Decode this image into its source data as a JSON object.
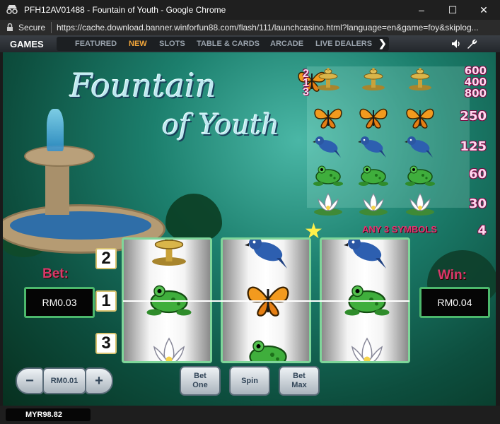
{
  "window": {
    "title": "PFH12AV01488 - Fountain of Youth - Google Chrome",
    "minimize": "–",
    "maximize": "☐",
    "close": "✕"
  },
  "address": {
    "secure_label": "Secure",
    "url": "https://cache.download.banner.winforfun88.com/flash/111/launchcasino.html?language=en&game=foy&skiplog..."
  },
  "nav": {
    "games_label": "GAMES",
    "tabs": [
      {
        "label": "FEATURED",
        "active": false
      },
      {
        "label": "NEW",
        "active": true
      },
      {
        "label": "SLOTS",
        "active": false
      },
      {
        "label": "TABLE & CARDS",
        "active": false
      },
      {
        "label": "ARCADE",
        "active": false
      },
      {
        "label": "LIVE DEALERS",
        "active": false
      }
    ],
    "next_arrow": "❯"
  },
  "game": {
    "logo_line1": "Fountain",
    "logo_line2": "of Youth",
    "paytable": {
      "rows": [
        {
          "symbol": "fountain",
          "payouts": [
            "600",
            "400",
            "800"
          ],
          "stack": [
            "2",
            "1",
            "3"
          ]
        },
        {
          "symbol": "butterfly",
          "payout": "250"
        },
        {
          "symbol": "bluebird",
          "payout": "125"
        },
        {
          "symbol": "frog",
          "payout": "60"
        },
        {
          "symbol": "lotus",
          "payout": "30"
        }
      ],
      "any3_label": "ANY 3 SYMBOLS",
      "any3_payout": "4"
    },
    "reels": [
      [
        "fountain",
        "frog",
        "lotus"
      ],
      [
        "bluebird",
        "butterfly",
        "frog"
      ],
      [
        "bluebird",
        "frog",
        "lotus"
      ]
    ],
    "lines": [
      "2",
      "1",
      "3"
    ],
    "bet_label": "Bet:",
    "bet_value": "RM0.03",
    "win_label": "Win:",
    "win_value": "RM0.04",
    "coin_value": "RM0.01",
    "minus_label": "−",
    "plus_label": "+",
    "bet_one_label_1": "Bet",
    "bet_one_label_2": "One",
    "spin_label": "Spin",
    "bet_max_label_1": "Bet",
    "bet_max_label_2": "Max"
  },
  "status": {
    "balance": "MYR98.82"
  }
}
